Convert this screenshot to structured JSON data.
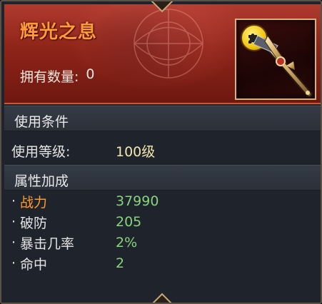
{
  "item": {
    "name": "辉光之息",
    "owned_label": "拥有数量:",
    "owned_value": "0",
    "icon": "jigsaw-puzzle-icon"
  },
  "requirements": {
    "title": "使用条件",
    "level_label": "使用等级:",
    "level_value": "100级"
  },
  "attributes": {
    "title": "属性加成",
    "stats": [
      {
        "label": "战力",
        "value": "37990"
      },
      {
        "label": "破防",
        "value": "205"
      },
      {
        "label": "暴击几率",
        "value": "2%"
      },
      {
        "label": "命中",
        "value": "2"
      }
    ]
  },
  "colors": {
    "title": "#ff9a3c",
    "highlight_stat": "#ff9a2e",
    "stat_value": "#86d47c",
    "level_value": "#f3e7b0",
    "header_red": "#8e2419"
  }
}
